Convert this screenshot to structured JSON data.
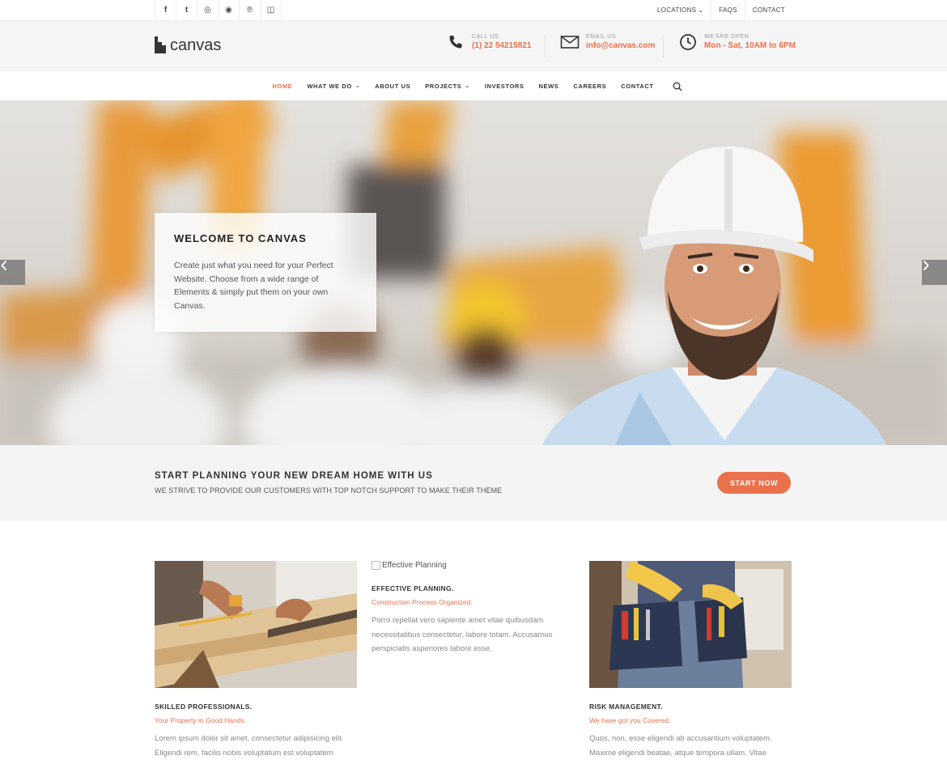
{
  "topbar": {
    "social": [
      {
        "icon": "facebook-icon",
        "glyph": "f"
      },
      {
        "icon": "twitter-icon",
        "glyph": "t"
      },
      {
        "icon": "dribbble-icon",
        "glyph": "◎"
      },
      {
        "icon": "github-icon",
        "glyph": "◉"
      },
      {
        "icon": "pinterest-icon",
        "glyph": "℗"
      },
      {
        "icon": "instagram-icon",
        "glyph": "◫"
      }
    ],
    "links": {
      "locations": "LOCATIONS",
      "locations_chevron": "⌄",
      "faqs": "FAQS",
      "contact": "CONTACT"
    }
  },
  "header": {
    "logo_text": "canvas",
    "call": {
      "label": "CALL US",
      "value": "(1) 22 54215821"
    },
    "email": {
      "label": "EMAIL US",
      "value": "info@canvas.com"
    },
    "hours": {
      "label": "WE'ARE OPEN",
      "value": "Mon - Sat, 10AM to 6PM"
    }
  },
  "nav": {
    "items": [
      {
        "label": "HOME"
      },
      {
        "label": "WHAT WE DO",
        "chev": "⌄"
      },
      {
        "label": "ABOUT US"
      },
      {
        "label": "PROJECTS",
        "chev": "⌄"
      },
      {
        "label": "INVESTORS"
      },
      {
        "label": "NEWS"
      },
      {
        "label": "CAREERS"
      },
      {
        "label": "CONTACT"
      }
    ],
    "search_icon": "search-icon"
  },
  "hero": {
    "title": "WELCOME TO CANVAS",
    "text": "Create just what you need for your Perfect Website. Choose from a wide range of Elements & simply put them on your own Canvas.",
    "prev_icon": "chevron-left-icon",
    "next_icon": "chevron-right-icon"
  },
  "promo": {
    "title": "START PLANNING YOUR NEW DREAM HOME WITH US",
    "subtitle": "WE STRIVE TO PROVIDE OUR CUSTOMERS WITH TOP NOTCH SUPPORT TO MAKE THEIR THEME",
    "button": "START NOW"
  },
  "features": [
    {
      "title": "SKILLED PROFESSIONALS.",
      "sub": "Your Property in Good Hands.",
      "desc": "Lorem ipsum dolor sit amet, consectetur adipisicing elit. Eligendi rem, facilis nobis voluptatum est voluptatem"
    },
    {
      "img_alt": "Effective Planning",
      "title": "EFFECTIVE PLANNING.",
      "sub": "Construction Process Organized.",
      "desc": "Porro repellat vero sapiente amet vitae quibusdam necessitatibus consectetur, labore totam. Accusamus perspiciatis asperiores labore esse."
    },
    {
      "title": "RISK MANAGEMENT.",
      "sub": "We have got you Covered.",
      "desc": "Quos, non, esse eligendi ab accusantium voluptatem. Maxime eligendi beatae, atque tempora ullam. Vitae"
    }
  ],
  "colors": {
    "accent": "#e9714b",
    "promo_bg": "#f4f4f4",
    "header_bg": "#f5f5f5"
  }
}
